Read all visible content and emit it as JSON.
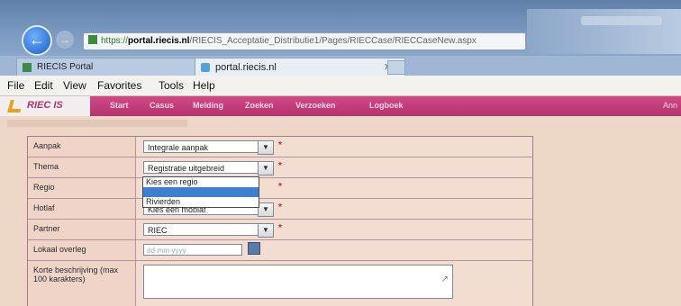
{
  "browser": {
    "address": {
      "https": "https://",
      "host": "portal.riecis.nl",
      "path": "/RIECIS_Acceptatie_Distributie1/Pages/RIECCase/RIECCaseNew.aspx"
    },
    "tabs": [
      {
        "label": "RIECIS Portal"
      },
      {
        "label": "portal.riecis.nl",
        "close": "✕"
      }
    ],
    "menu": [
      "File",
      "Edit",
      "View",
      "Favorites",
      "Tools",
      "Help"
    ]
  },
  "app": {
    "logo_text": "RIEC IS",
    "nav": [
      "Start",
      "Casus",
      "Melding",
      "Zoeken",
      "Verzoeken",
      "Logboek"
    ],
    "nav_right": "Ann"
  },
  "form": {
    "rows": [
      {
        "label": "Aanpak",
        "value": "Integrale aanpak",
        "required": "*"
      },
      {
        "label": "Thema",
        "value": "Registratie uitgebreid",
        "required": "*"
      },
      {
        "label": "Regio",
        "value": "Kies een regio",
        "required": "*"
      },
      {
        "label": "Hotlaf",
        "value": "Kies een moblaf",
        "required": "*"
      },
      {
        "label": "Partner",
        "value": "RIEC",
        "required": "*"
      },
      {
        "label": "Lokaal overleg",
        "placeholder": "dd-mm-yyyy"
      },
      {
        "label": "Korte beschrijving (max 100 karakters)"
      }
    ],
    "regio_dropdown": [
      {
        "label": "Kies een regio",
        "highlighted": false
      },
      {
        "label": "",
        "highlighted": true
      },
      {
        "label": "Rivierden",
        "highlighted": false
      }
    ]
  },
  "colors": {
    "accent": "#b53370",
    "content_bg": "#efd7c8"
  }
}
